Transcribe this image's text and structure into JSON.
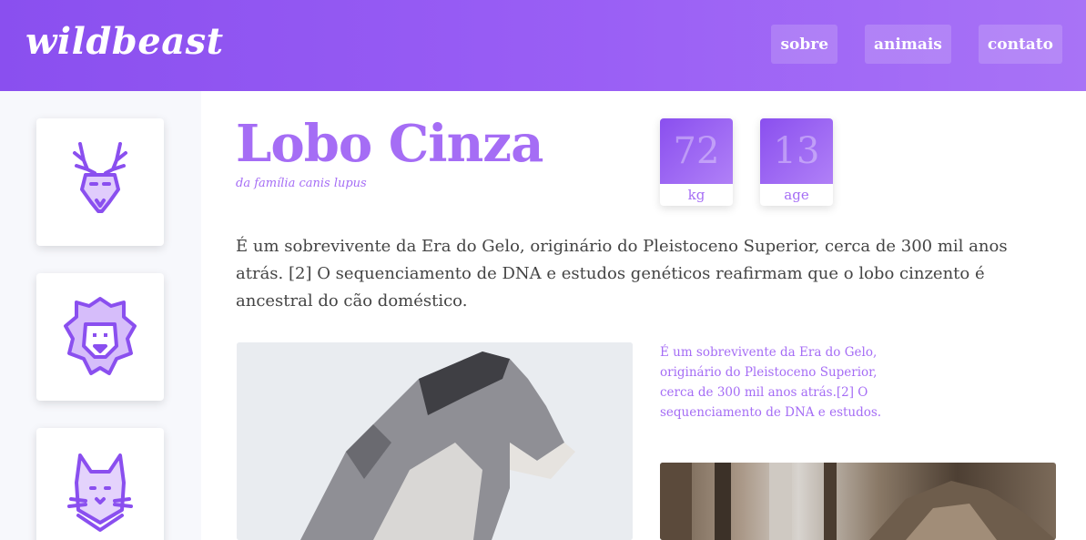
{
  "header": {
    "brand": "wildbeast",
    "nav": [
      {
        "label": "sobre"
      },
      {
        "label": "animais"
      },
      {
        "label": "contato"
      }
    ]
  },
  "sidebar": {
    "items": [
      {
        "icon": "deer-icon"
      },
      {
        "icon": "lion-icon"
      },
      {
        "icon": "cat-icon"
      }
    ]
  },
  "animal": {
    "name": "Lobo Cinza",
    "family": "da família canis lupus",
    "stats": [
      {
        "value": "72",
        "label": "kg"
      },
      {
        "value": "13",
        "label": "age"
      }
    ],
    "description": "É um sobrevivente da Era do Gelo, originário do Pleistoceno Superior, cerca de 300 mil anos atrás. [2] O sequenciamento de DNA e estudos genéticos reafirmam que o lobo cinzento é ancestral do cão doméstico.",
    "caption": "É um sobrevivente da Era do Gelo, originário do Pleistoceno Superior, cerca de 300 mil anos atrás.[2] O sequenciamento de DNA e estudos."
  },
  "colors": {
    "accent": "#a56df5",
    "header_start": "#8a4fef",
    "header_end": "#a873f6",
    "icon": "#8a4fef"
  }
}
